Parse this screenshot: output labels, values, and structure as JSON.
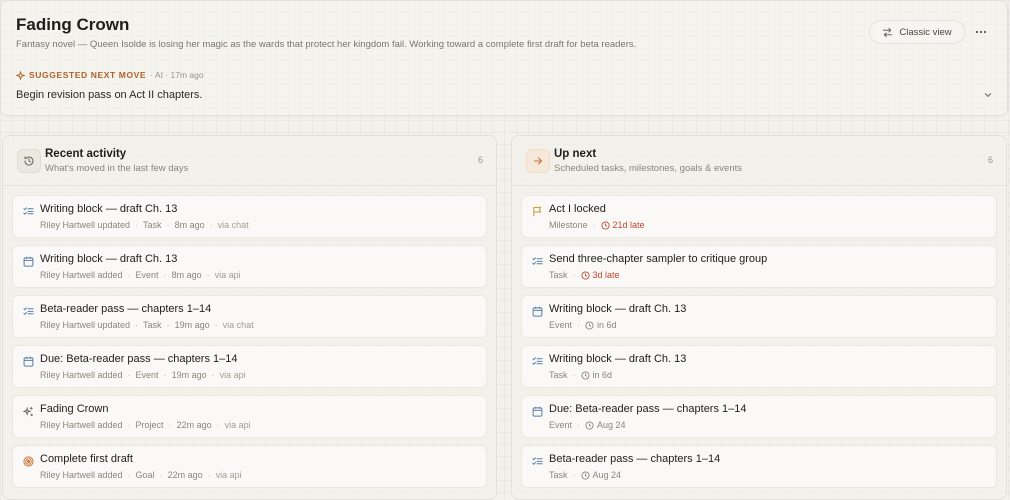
{
  "project": {
    "title": "Fading Crown",
    "description": "Fantasy novel — Queen Isolde is losing her magic as the wards that protect her kingdom fail. Working toward a complete first draft for beta readers."
  },
  "header": {
    "classic_view_label": "Classic view",
    "more_icon": "more-horizontal-icon"
  },
  "suggestion": {
    "label": "SUGGESTED NEXT MOVE",
    "meta": "· AI · 17m ago",
    "text": "Begin revision pass on Act II chapters."
  },
  "colors": {
    "accent": "#b0612b",
    "late": "#c0492e",
    "task_blue": "#5b7fa8",
    "milestone_amber": "#c79a2c",
    "goal_orange": "#c9743a"
  },
  "recent": {
    "title": "Recent activity",
    "subtitle": "What's moved in the last few days",
    "count": "6",
    "items": [
      {
        "icon": "task-list-icon",
        "title": "Writing block — draft Ch. 13",
        "who": "Riley Hartwell updated",
        "type": "Task",
        "time": "8m ago",
        "via": "via chat"
      },
      {
        "icon": "calendar-icon",
        "title": "Writing block — draft Ch. 13",
        "who": "Riley Hartwell added",
        "type": "Event",
        "time": "8m ago",
        "via": "via api"
      },
      {
        "icon": "task-list-icon",
        "title": "Beta-reader pass — chapters 1–14",
        "who": "Riley Hartwell updated",
        "type": "Task",
        "time": "19m ago",
        "via": "via chat"
      },
      {
        "icon": "calendar-icon",
        "title": "Due: Beta-reader pass — chapters 1–14",
        "who": "Riley Hartwell added",
        "type": "Event",
        "time": "19m ago",
        "via": "via api"
      },
      {
        "icon": "sparkles-icon",
        "title": "Fading Crown",
        "who": "Riley Hartwell added",
        "type": "Project",
        "time": "22m ago",
        "via": "via api"
      },
      {
        "icon": "target-icon",
        "title": "Complete first draft",
        "who": "Riley Hartwell added",
        "type": "Goal",
        "time": "22m ago",
        "via": "via api"
      }
    ]
  },
  "upnext": {
    "title": "Up next",
    "subtitle": "Scheduled tasks, milestones, goals & events",
    "count": "6",
    "items": [
      {
        "icon": "flag-icon",
        "title": "Act I locked",
        "type": "Milestone",
        "when": "21d late",
        "late": true
      },
      {
        "icon": "task-list-icon",
        "title": "Send three-chapter sampler to critique group",
        "type": "Task",
        "when": "3d late",
        "late": true
      },
      {
        "icon": "calendar-icon",
        "title": "Writing block — draft Ch. 13",
        "type": "Event",
        "when": "in 6d",
        "late": false
      },
      {
        "icon": "task-list-icon",
        "title": "Writing block — draft Ch. 13",
        "type": "Task",
        "when": "in 6d",
        "late": false
      },
      {
        "icon": "calendar-icon",
        "title": "Due: Beta-reader pass — chapters 1–14",
        "type": "Event",
        "when": "Aug 24",
        "late": false
      },
      {
        "icon": "task-list-icon",
        "title": "Beta-reader pass — chapters 1–14",
        "type": "Task",
        "when": "Aug 24",
        "late": false
      }
    ]
  }
}
